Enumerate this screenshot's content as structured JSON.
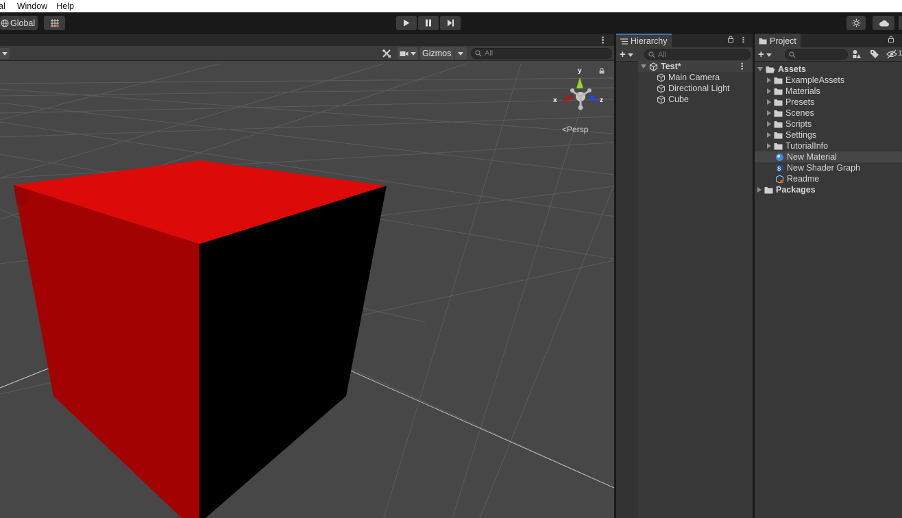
{
  "menu": {
    "items": [
      "al",
      "Window",
      "Help"
    ]
  },
  "toolbar": {
    "global_label": "Global"
  },
  "scene": {
    "gizmos_label": "Gizmos",
    "search_placeholder": "All",
    "persp_label": "Persp",
    "axis_x": "x",
    "axis_y": "y",
    "axis_z": "z",
    "cube_colors": {
      "top": "#dd0a0a",
      "left": "#a20202",
      "right": "#000000"
    }
  },
  "hierarchy": {
    "tab_label": "Hierarchy",
    "search_placeholder": "All",
    "scene_name": "Test*",
    "items": [
      "Main Camera",
      "Directional Light",
      "Cube"
    ]
  },
  "project": {
    "tab_label": "Project",
    "root": "Assets",
    "folders": [
      "ExampleAssets",
      "Materials",
      "Presets",
      "Scenes",
      "Scripts",
      "Settings",
      "TutorialInfo"
    ],
    "assets": [
      "New Material",
      "New Shader Graph",
      "Readme"
    ],
    "packages": "Packages",
    "hidden_count": "1"
  }
}
